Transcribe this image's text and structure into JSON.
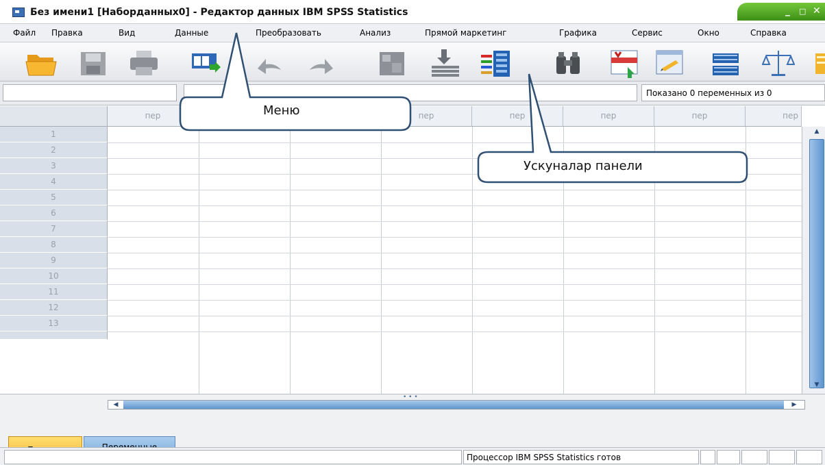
{
  "window": {
    "title": "Без имени1 [Наборданных0] - Редактор данных IBM SPSS Statistics",
    "controls": [
      "_",
      "□",
      "✕"
    ]
  },
  "menu": [
    "Файл",
    "Правка",
    "Вид",
    "Данные",
    "Преобразовать",
    "Анализ",
    "Прямой маркетинг",
    "Графика",
    "Сервис",
    "Окно",
    "Справка"
  ],
  "toolbar": {
    "icons": [
      "open-folder-icon",
      "save-icon",
      "print-icon",
      "recall-dialog-icon",
      "undo-icon",
      "redo-icon",
      "goto-case-icon",
      "goto-variable-icon",
      "variables-icon",
      "find-icon",
      "insert-cases-icon",
      "insert-variable-icon",
      "split-file-icon",
      "weight-cases-icon"
    ]
  },
  "cell_editor": {
    "cell_ref": "",
    "value": "",
    "variable_count": "Показано 0 переменных из 0"
  },
  "grid": {
    "column_headers": [
      "пер",
      "пер",
      "пер",
      "пер",
      "пер",
      "пер",
      "пер",
      "пер"
    ],
    "row_numbers": [
      "1",
      "2",
      "3",
      "4",
      "5",
      "6",
      "7",
      "8",
      "9",
      "10",
      "11",
      "12",
      "13"
    ]
  },
  "tabs": {
    "data": "Данные",
    "variables": "Переменные"
  },
  "status": {
    "processor": "Процессор IBM SPSS Statistics  готов"
  },
  "annotations": {
    "menu_label": "Меню",
    "toolbar_label": "Ускуналар панели"
  },
  "colors": {
    "menu_bg": "#eef0f3",
    "active_tab": "#f3b33b",
    "inactive_tab": "#77a9dd",
    "title_controls": "#3d8f17",
    "grid_header_text": "#9aa1ab"
  }
}
